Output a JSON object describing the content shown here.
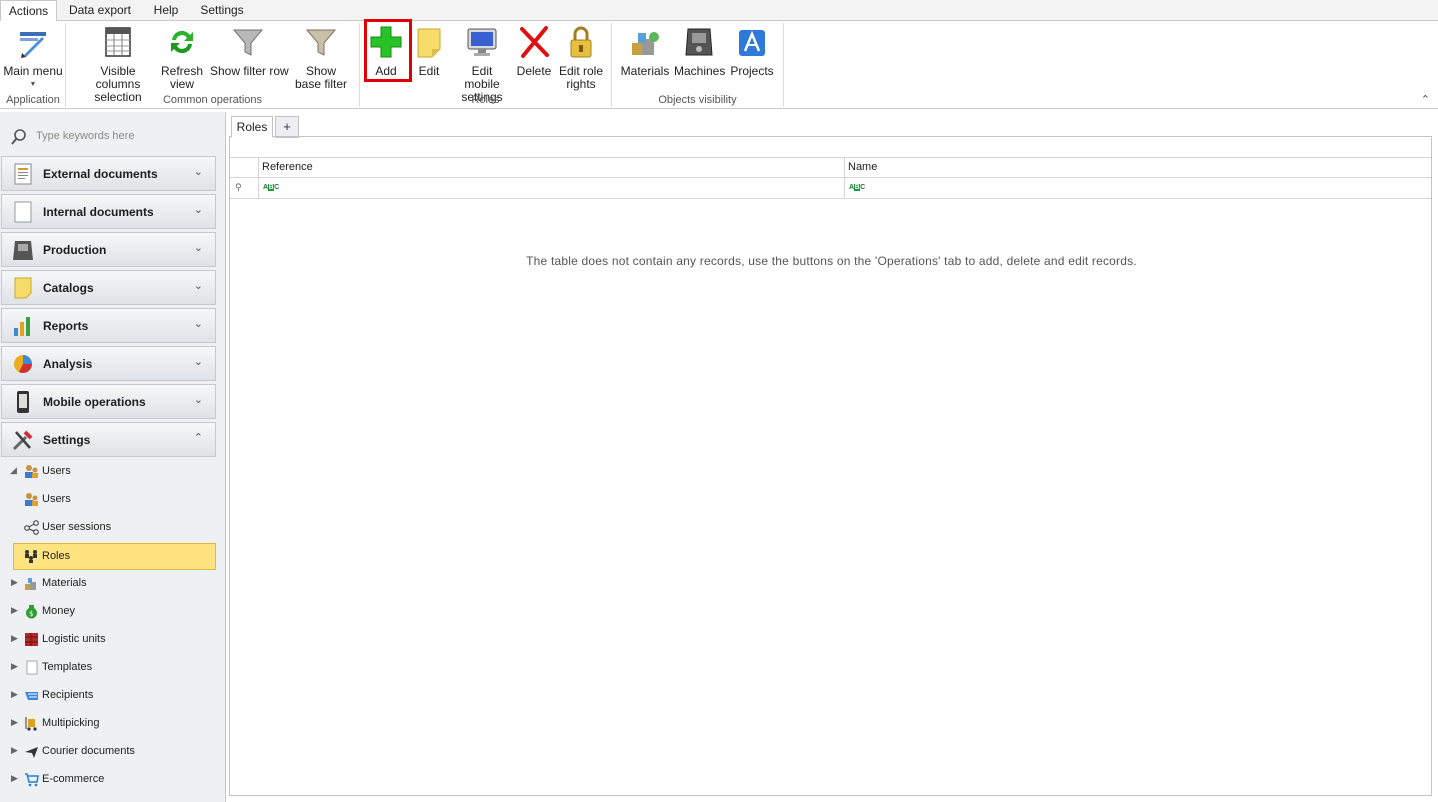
{
  "menu_tabs": [
    "Actions",
    "Data export",
    "Help",
    "Settings"
  ],
  "ribbon": {
    "buttons": {
      "main_menu": "Main menu",
      "visible_columns": "Visible columns selection",
      "refresh_view": "Refresh view",
      "show_filter_row": "Show filter row",
      "show_base_filter": "Show base filter",
      "add": "Add",
      "edit": "Edit",
      "edit_mobile_settings": "Edit mobile settings",
      "delete": "Delete",
      "edit_role_rights": "Edit role rights",
      "materials": "Materials",
      "machines": "Machines",
      "projects": "Projects"
    },
    "groups": {
      "application": "Application",
      "common_operations": "Common operations",
      "roles": "Roles",
      "objects_visibility": "Objects visibility"
    }
  },
  "sidebar": {
    "search_placeholder": "Type keywords here",
    "groups": [
      "External documents",
      "Internal documents",
      "Production",
      "Catalogs",
      "Reports",
      "Analysis",
      "Mobile operations",
      "Settings"
    ],
    "tree": [
      "Users",
      "Users",
      "User sessions",
      "Roles",
      "Materials",
      "Money",
      "Logistic units",
      "Templates",
      "Recipients",
      "Multipicking",
      "Courier documents",
      "E-commerce"
    ]
  },
  "content": {
    "tabs": [
      "Roles",
      "+"
    ],
    "columns": [
      "Reference",
      "Name"
    ],
    "filter_glyph": [
      "A",
      "B",
      "C"
    ],
    "empty_message": "The table does not contain any records, use the buttons on the 'Operations' tab to add, delete and edit records."
  },
  "colors": {
    "selected_bg": "#ffe481",
    "highlight_border": "#e00000",
    "sidebar_bg": "#eef0f3"
  }
}
